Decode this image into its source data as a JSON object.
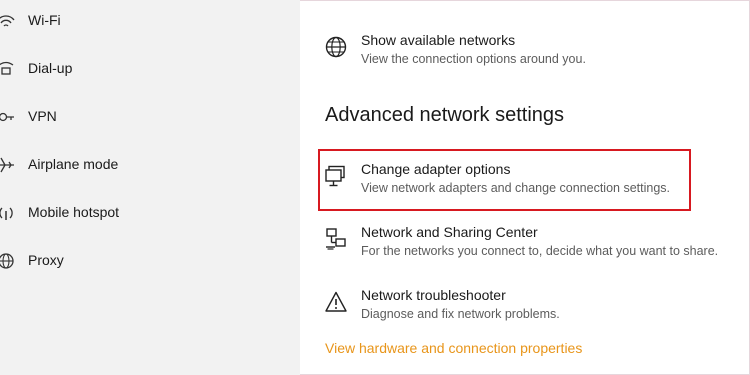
{
  "sidebar": {
    "items": [
      {
        "icon": "wifi-icon",
        "label": "Wi-Fi"
      },
      {
        "icon": "dialup-icon",
        "label": "Dial-up"
      },
      {
        "icon": "vpn-icon",
        "label": "VPN"
      },
      {
        "icon": "airplane-icon",
        "label": "Airplane mode"
      },
      {
        "icon": "hotspot-icon",
        "label": "Mobile hotspot"
      },
      {
        "icon": "globe-icon",
        "label": "Proxy"
      }
    ]
  },
  "main": {
    "show_networks": {
      "icon": "globe-icon",
      "title": "Show available networks",
      "description": "View the connection options around you."
    },
    "section_heading": "Advanced network settings",
    "entries": [
      {
        "icon": "monitor-icon",
        "title": "Change adapter options",
        "description": "View network adapters and change connection settings."
      },
      {
        "icon": "network-sharing-icon",
        "title": "Network and Sharing Center",
        "description": "For the networks you connect to, decide what you want to share."
      },
      {
        "icon": "warning-icon",
        "title": "Network troubleshooter",
        "description": "Diagnose and fix network problems."
      }
    ],
    "link_text": "View hardware and connection properties"
  },
  "colors": {
    "sidebar_bg": "#f2f2f2",
    "highlight_border": "#d71920",
    "link": "#e8951a"
  }
}
